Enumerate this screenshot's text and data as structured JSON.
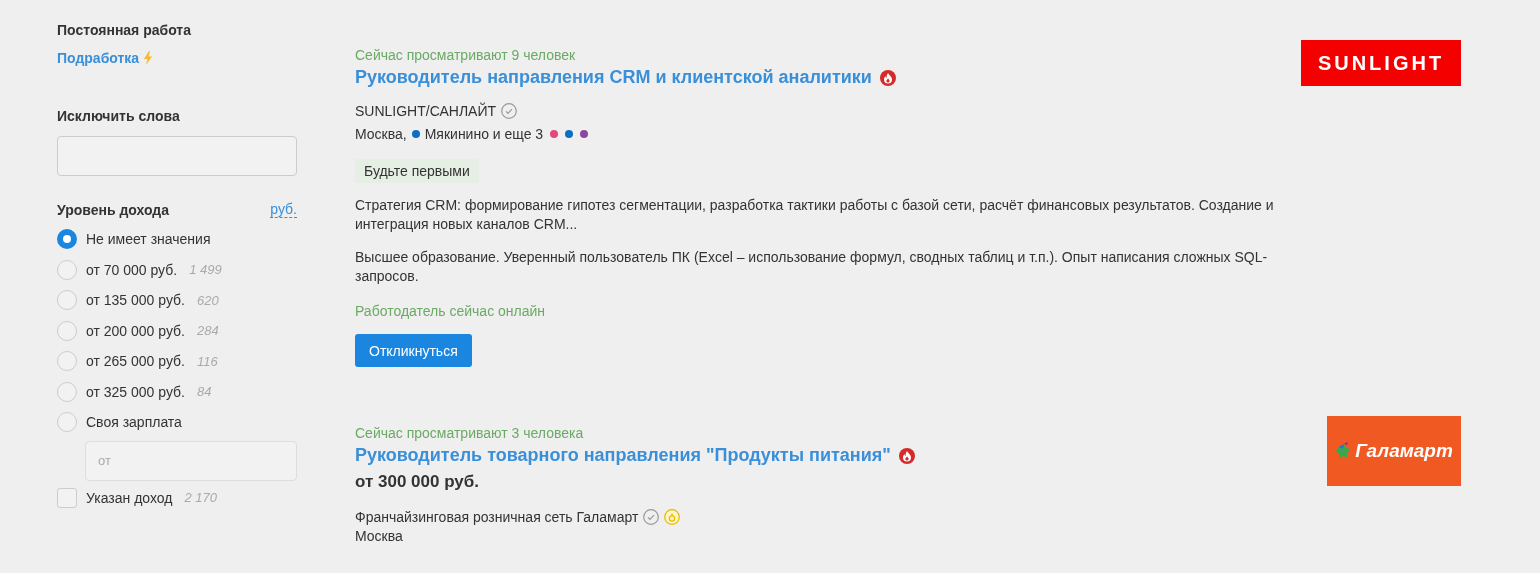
{
  "sidebar": {
    "employment": {
      "heading": "Постоянная работа",
      "link": "Подработка",
      "link_bolt": true
    },
    "exclude": {
      "heading": "Исключить слова"
    },
    "income": {
      "heading": "Уровень дохода",
      "currency": "руб.",
      "options": [
        {
          "label": "Не имеет значения",
          "selected": true
        },
        {
          "label": "от 70 000 руб.",
          "count": "1 499",
          "selected": false
        },
        {
          "label": "от 135 000 руб.",
          "count": "620",
          "selected": false
        },
        {
          "label": "от 200 000 руб.",
          "count": "284",
          "selected": false
        },
        {
          "label": "от 265 000 руб.",
          "count": "116",
          "selected": false
        },
        {
          "label": "от 325 000 руб.",
          "count": "84",
          "selected": false
        },
        {
          "label": "Своя зарплата",
          "selected": false
        }
      ],
      "custom_placeholder": "от",
      "with_income": {
        "label": "Указан доход",
        "count": "2 170",
        "checked": false
      }
    }
  },
  "vacancies": [
    {
      "viewers": "Сейчас просматривают 9 человек",
      "title": "Руководитель направления CRM и клиентской аналитики",
      "hot": true,
      "company": "SUNLIGHT/САНЛАЙТ",
      "verified": true,
      "money_badge": false,
      "logo": {
        "kind": "sunlight",
        "text": "SUNLIGHT"
      },
      "city": "Москва,",
      "metro": {
        "name": "Мякинино",
        "color": "#0a6fc2"
      },
      "more": "и еще 3",
      "more_stations": [
        {
          "color": "#e4477f"
        },
        {
          "color": "#0a6fc2"
        },
        {
          "color": "#8e479c"
        }
      ],
      "badge": "Будьте первыми",
      "paragraphs": [
        "Стратегия CRM: формирование гипотез сегментации, разработка тактики работы с базой сети, расчёт финансовых результатов. Создание и интеграция новых каналов CRM...",
        "Высшее образование. Уверенный пользователь ПК (Excel – использование формул, сводных таблиц и т.п.). Опыт написания сложных SQL-запросов."
      ],
      "online": "Работодатель сейчас онлайн",
      "button": "Откликнуться"
    },
    {
      "viewers": "Сейчас просматривают 3 человека",
      "title": "Руководитель товарного направления \"Продукты питания\"",
      "hot": true,
      "salary": "от 300 000 руб.",
      "company": "Франчайзинговая розничная сеть Галамарт",
      "verified": true,
      "money_badge": true,
      "logo": {
        "kind": "galamart",
        "text": "Галамарт"
      },
      "city": "Москва"
    }
  ]
}
